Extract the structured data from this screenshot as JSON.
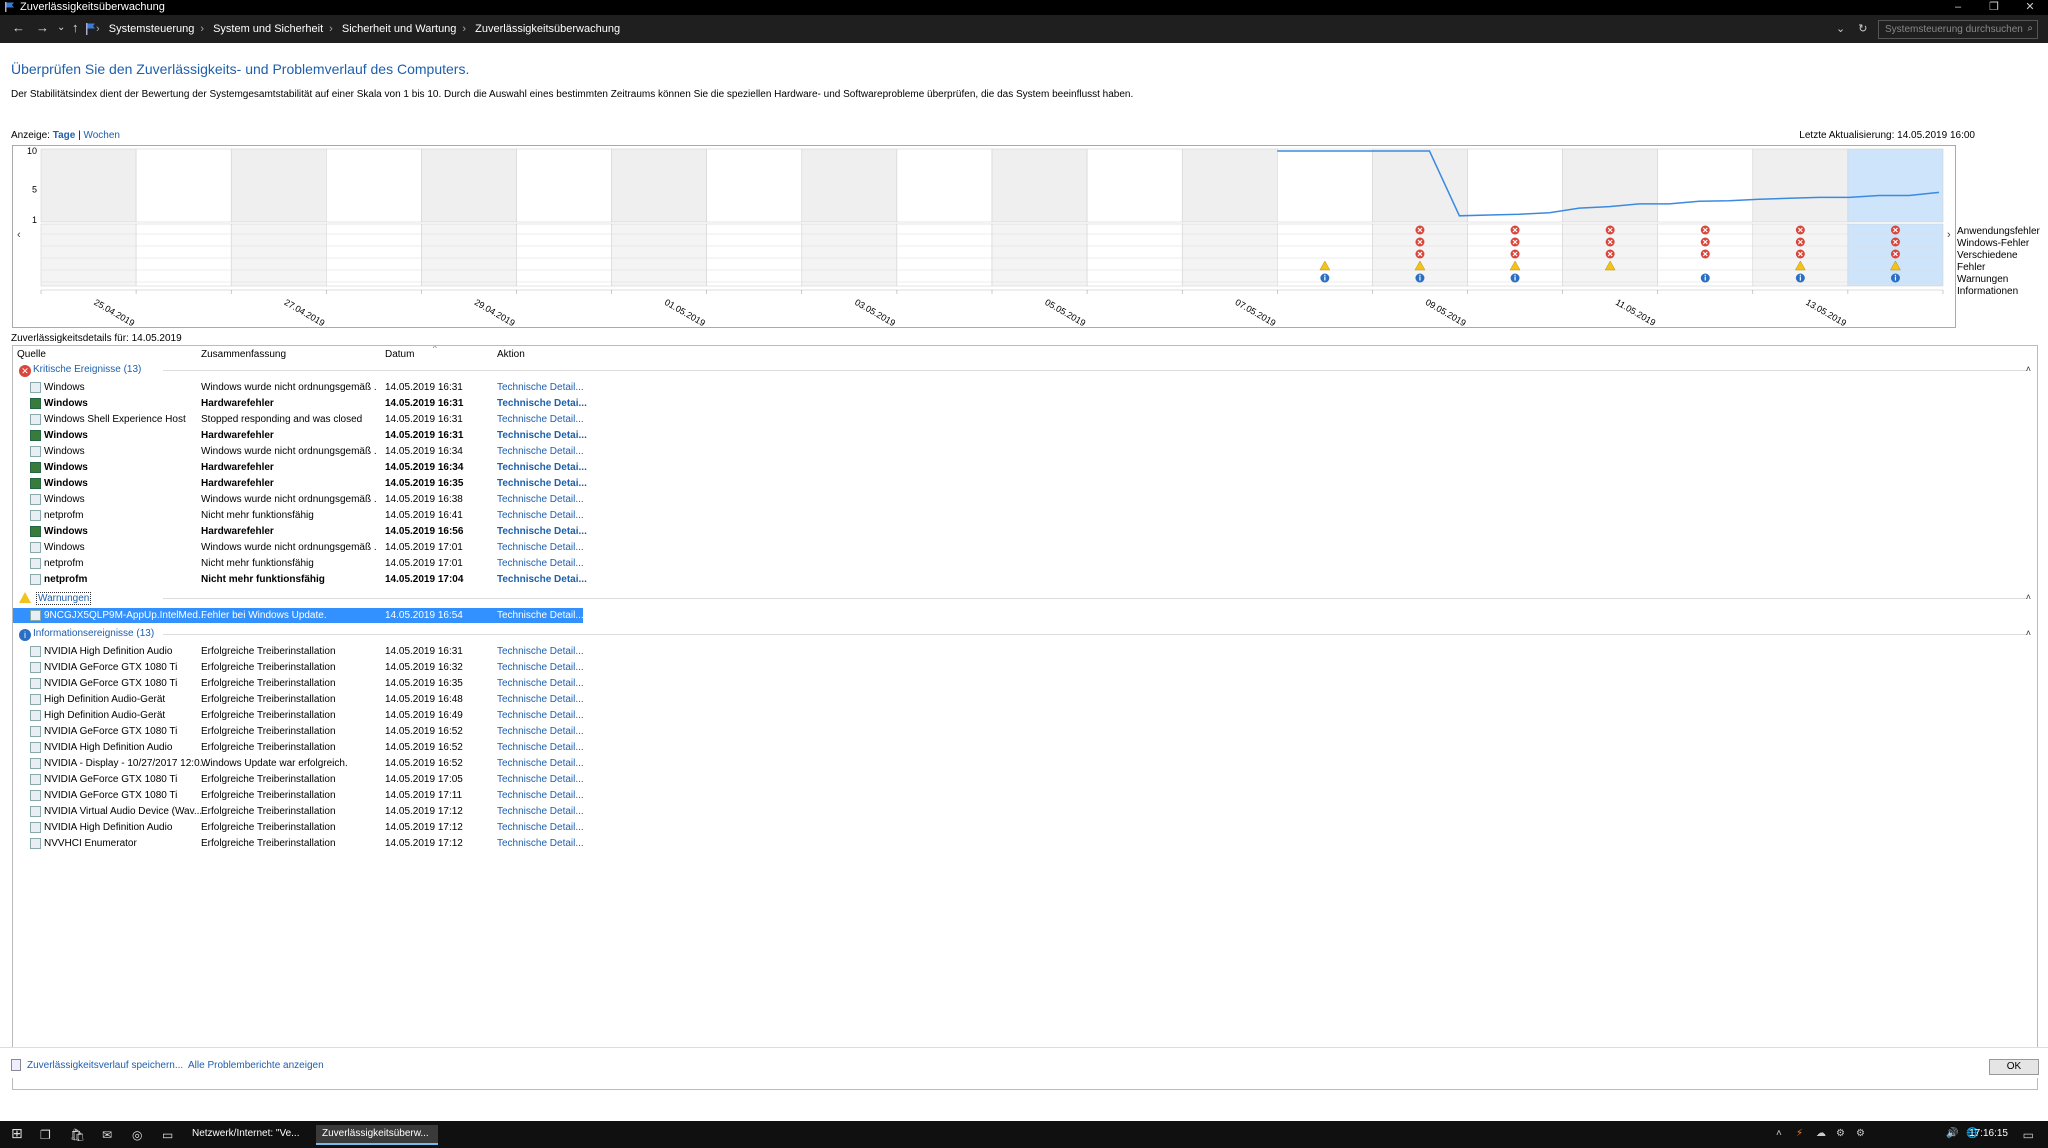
{
  "window": {
    "title": "Zuverlässigkeitsüberwachung",
    "minimize": "–",
    "restore": "❐",
    "close": "✕"
  },
  "nav": {
    "back": "←",
    "forward": "→",
    "recent": "⌄",
    "up": "↑",
    "breadcrumbs": [
      "Systemsteuerung",
      "System und Sicherheit",
      "Sicherheit und Wartung",
      "Zuverlässigkeitsüberwachung"
    ],
    "dropdown": "⌄",
    "refresh": "↻",
    "search_placeholder": "Systemsteuerung durchsuchen"
  },
  "heading": "Überprüfen Sie den Zuverlässigkeits- und Problemverlauf des Computers.",
  "description": "Der Stabilitätsindex dient der Bewertung der Systemgesamtstabilität auf einer Skala von 1 bis 10. Durch die Auswahl eines bestimmten Zeitraums können Sie die speziellen Hardware- und Softwareprobleme überprüfen, die das System beeinflusst haben.",
  "view": {
    "label": "Anzeige:",
    "days": "Tage",
    "sep": "|",
    "weeks": "Wochen"
  },
  "last_update": "Letzte Aktualisierung: 14.05.2019 16:00",
  "chart_data": {
    "type": "line",
    "y_ticks": [
      "10",
      "5",
      "1"
    ],
    "ylim": [
      1,
      10
    ],
    "x_labels": [
      "25.04.2019",
      "27.04.2019",
      "29.04.2019",
      "01.05.2019",
      "03.05.2019",
      "05.05.2019",
      "07.05.2019",
      "09.05.2019",
      "11.05.2019",
      "13.05.2019"
    ],
    "columns": 20,
    "first_data_column": 13,
    "selected_column": 19,
    "stability": [
      10,
      10,
      1.55,
      1.65,
      1.75,
      1.95,
      2.55,
      2.75,
      3.1,
      3.1,
      3.45,
      3.5,
      3.7,
      3.85,
      3.95,
      3.95,
      4.2,
      4.2,
      4.6
    ],
    "rows": [
      "Anwendungsfehler",
      "Windows-Fehler",
      "Verschiedene Fehler",
      "Warnungen",
      "Informationen"
    ],
    "markers": [
      {
        "column": 13,
        "row": 3,
        "kind": "warning"
      },
      {
        "column": 13,
        "row": 4,
        "kind": "info"
      },
      {
        "column": 14,
        "row": 0,
        "kind": "error"
      },
      {
        "column": 14,
        "row": 1,
        "kind": "error"
      },
      {
        "column": 14,
        "row": 2,
        "kind": "error"
      },
      {
        "column": 14,
        "row": 3,
        "kind": "warning"
      },
      {
        "column": 14,
        "row": 4,
        "kind": "info"
      },
      {
        "column": 15,
        "row": 0,
        "kind": "error"
      },
      {
        "column": 15,
        "row": 1,
        "kind": "error"
      },
      {
        "column": 15,
        "row": 2,
        "kind": "error"
      },
      {
        "column": 15,
        "row": 3,
        "kind": "warning"
      },
      {
        "column": 15,
        "row": 4,
        "kind": "info"
      },
      {
        "column": 16,
        "row": 0,
        "kind": "error"
      },
      {
        "column": 16,
        "row": 1,
        "kind": "error"
      },
      {
        "column": 16,
        "row": 2,
        "kind": "error"
      },
      {
        "column": 16,
        "row": 3,
        "kind": "warning"
      },
      {
        "column": 17,
        "row": 0,
        "kind": "error"
      },
      {
        "column": 17,
        "row": 1,
        "kind": "error"
      },
      {
        "column": 17,
        "row": 2,
        "kind": "error"
      },
      {
        "column": 17,
        "row": 4,
        "kind": "info"
      },
      {
        "column": 18,
        "row": 0,
        "kind": "error"
      },
      {
        "column": 18,
        "row": 1,
        "kind": "error"
      },
      {
        "column": 18,
        "row": 2,
        "kind": "error"
      },
      {
        "column": 18,
        "row": 3,
        "kind": "warning"
      },
      {
        "column": 18,
        "row": 4,
        "kind": "info"
      },
      {
        "column": 19,
        "row": 0,
        "kind": "error"
      },
      {
        "column": 19,
        "row": 1,
        "kind": "error"
      },
      {
        "column": 19,
        "row": 2,
        "kind": "error"
      },
      {
        "column": 19,
        "row": 3,
        "kind": "warning"
      },
      {
        "column": 19,
        "row": 4,
        "kind": "info"
      }
    ],
    "scroll_left": "‹",
    "scroll_right": "›"
  },
  "details_header": "Zuverlässigkeitsdetails für: 14.05.2019",
  "columns": {
    "source": "Quelle",
    "summary": "Zusammenfassung",
    "date": "Datum",
    "action": "Aktion",
    "sort_indicator": "^"
  },
  "groups": [
    {
      "title": "Kritische Ereignisse (13)",
      "icon": "error",
      "collapse": "˄",
      "rows": [
        {
          "source": "Windows",
          "summary": "Windows wurde nicht ordnungsgemäß ...",
          "date": "14.05.2019 16:31",
          "action": "Technische Detail...",
          "bold": false,
          "icon": "doc"
        },
        {
          "source": "Windows",
          "summary": "Hardwarefehler",
          "date": "14.05.2019 16:31",
          "action": "Technische Detai...",
          "bold": true,
          "icon": "win"
        },
        {
          "source": "Windows Shell Experience Host",
          "summary": "Stopped responding and was closed",
          "date": "14.05.2019 16:31",
          "action": "Technische Detail...",
          "bold": false,
          "icon": "doc"
        },
        {
          "source": "Windows",
          "summary": "Hardwarefehler",
          "date": "14.05.2019 16:31",
          "action": "Technische Detai...",
          "bold": true,
          "icon": "win"
        },
        {
          "source": "Windows",
          "summary": "Windows wurde nicht ordnungsgemäß ...",
          "date": "14.05.2019 16:34",
          "action": "Technische Detail...",
          "bold": false,
          "icon": "doc"
        },
        {
          "source": "Windows",
          "summary": "Hardwarefehler",
          "date": "14.05.2019 16:34",
          "action": "Technische Detai...",
          "bold": true,
          "icon": "win"
        },
        {
          "source": "Windows",
          "summary": "Hardwarefehler",
          "date": "14.05.2019 16:35",
          "action": "Technische Detai...",
          "bold": true,
          "icon": "win"
        },
        {
          "source": "Windows",
          "summary": "Windows wurde nicht ordnungsgemäß ...",
          "date": "14.05.2019 16:38",
          "action": "Technische Detail...",
          "bold": false,
          "icon": "doc"
        },
        {
          "source": "netprofm",
          "summary": "Nicht mehr funktionsfähig",
          "date": "14.05.2019 16:41",
          "action": "Technische Detail...",
          "bold": false,
          "icon": "doc"
        },
        {
          "source": "Windows",
          "summary": "Hardwarefehler",
          "date": "14.05.2019 16:56",
          "action": "Technische Detai...",
          "bold": true,
          "icon": "win"
        },
        {
          "source": "Windows",
          "summary": "Windows wurde nicht ordnungsgemäß ...",
          "date": "14.05.2019 17:01",
          "action": "Technische Detail...",
          "bold": false,
          "icon": "doc"
        },
        {
          "source": "netprofm",
          "summary": "Nicht mehr funktionsfähig",
          "date": "14.05.2019 17:01",
          "action": "Technische Detail...",
          "bold": false,
          "icon": "doc"
        },
        {
          "source": "netprofm",
          "summary": "Nicht mehr funktionsfähig",
          "date": "14.05.2019 17:04",
          "action": "Technische Detai...",
          "bold": true,
          "icon": "doc"
        }
      ]
    },
    {
      "title": "Warnungen",
      "icon": "warning",
      "collapse": "˄",
      "rows": [
        {
          "source": "9NCGJX5QLP9M-AppUp.IntelMed...",
          "summary": "Fehler bei Windows Update.",
          "date": "14.05.2019 16:54",
          "action": "Technische Detail...",
          "bold": false,
          "icon": "doc",
          "selected": true
        }
      ]
    },
    {
      "title": "Informationsereignisse (13)",
      "icon": "info",
      "collapse": "˄",
      "rows": [
        {
          "source": "NVIDIA High Definition Audio",
          "summary": "Erfolgreiche Treiberinstallation",
          "date": "14.05.2019 16:31",
          "action": "Technische Detail...",
          "bold": false,
          "icon": "doc"
        },
        {
          "source": "NVIDIA GeForce GTX 1080 Ti",
          "summary": "Erfolgreiche Treiberinstallation",
          "date": "14.05.2019 16:32",
          "action": "Technische Detail...",
          "bold": false,
          "icon": "doc"
        },
        {
          "source": "NVIDIA GeForce GTX 1080 Ti",
          "summary": "Erfolgreiche Treiberinstallation",
          "date": "14.05.2019 16:35",
          "action": "Technische Detail...",
          "bold": false,
          "icon": "doc"
        },
        {
          "source": "High Definition Audio-Gerät",
          "summary": "Erfolgreiche Treiberinstallation",
          "date": "14.05.2019 16:48",
          "action": "Technische Detail...",
          "bold": false,
          "icon": "doc"
        },
        {
          "source": "High Definition Audio-Gerät",
          "summary": "Erfolgreiche Treiberinstallation",
          "date": "14.05.2019 16:49",
          "action": "Technische Detail...",
          "bold": false,
          "icon": "doc"
        },
        {
          "source": "NVIDIA GeForce GTX 1080 Ti",
          "summary": "Erfolgreiche Treiberinstallation",
          "date": "14.05.2019 16:52",
          "action": "Technische Detail...",
          "bold": false,
          "icon": "doc"
        },
        {
          "source": "NVIDIA High Definition Audio",
          "summary": "Erfolgreiche Treiberinstallation",
          "date": "14.05.2019 16:52",
          "action": "Technische Detail...",
          "bold": false,
          "icon": "doc"
        },
        {
          "source": "NVIDIA - Display - 10/27/2017 12:0...",
          "summary": "Windows Update war erfolgreich.",
          "date": "14.05.2019 16:52",
          "action": "Technische Detail...",
          "bold": false,
          "icon": "doc"
        },
        {
          "source": "NVIDIA GeForce GTX 1080 Ti",
          "summary": "Erfolgreiche Treiberinstallation",
          "date": "14.05.2019 17:05",
          "action": "Technische Detail...",
          "bold": false,
          "icon": "doc"
        },
        {
          "source": "NVIDIA GeForce GTX 1080 Ti",
          "summary": "Erfolgreiche Treiberinstallation",
          "date": "14.05.2019 17:11",
          "action": "Technische Detail...",
          "bold": false,
          "icon": "doc"
        },
        {
          "source": "NVIDIA Virtual Audio Device (Wav...",
          "summary": "Erfolgreiche Treiberinstallation",
          "date": "14.05.2019 17:12",
          "action": "Technische Detail...",
          "bold": false,
          "icon": "doc"
        },
        {
          "source": "NVIDIA High Definition Audio",
          "summary": "Erfolgreiche Treiberinstallation",
          "date": "14.05.2019 17:12",
          "action": "Technische Detail...",
          "bold": false,
          "icon": "doc"
        },
        {
          "source": "NVVHCI Enumerator",
          "summary": "Erfolgreiche Treiberinstallation",
          "date": "14.05.2019 17:12",
          "action": "Technische Detail...",
          "bold": false,
          "icon": "doc"
        }
      ]
    }
  ],
  "footer": {
    "save_history": "Zuverlässigkeitsverlauf speichern...",
    "all_reports": "Alle Problemberichte anzeigen",
    "ok": "OK"
  },
  "taskbar": {
    "start": "⊞",
    "task_view": "❐",
    "store": "🛍",
    "mail": "✉",
    "chrome": "◎",
    "explorer": "▭",
    "tasks": [
      {
        "label": "Netzwerk/Internet: \"Ve...",
        "active": false
      },
      {
        "label": "Zuverlässigkeitsüberw...",
        "active": true
      }
    ],
    "tray": [
      "˄",
      "⚡",
      "☁",
      "⚙",
      "⚙",
      "🔊",
      "🌐"
    ],
    "time": "17:16:15",
    "notifications": "▭"
  }
}
